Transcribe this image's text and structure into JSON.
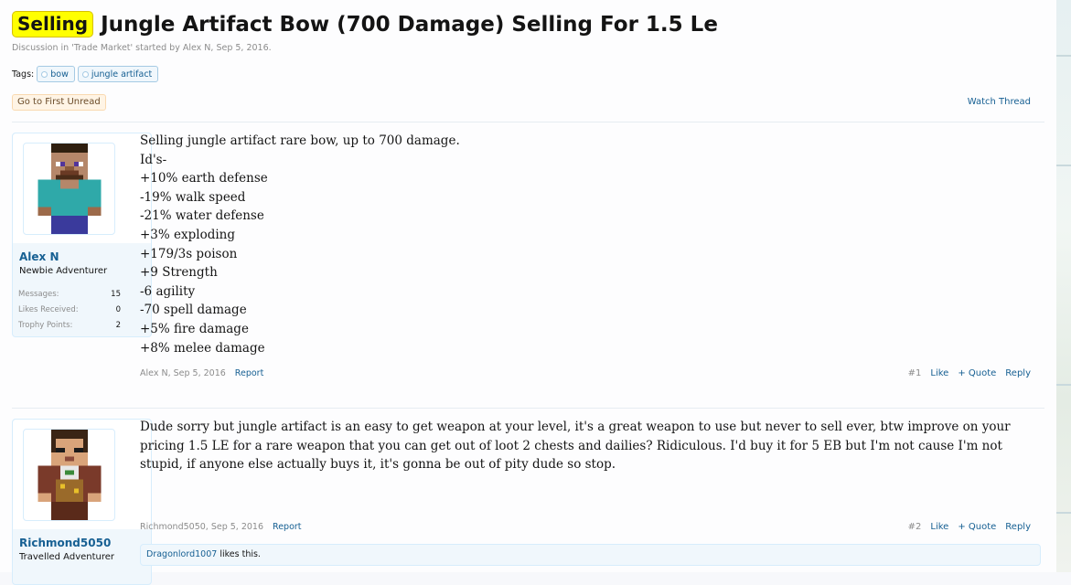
{
  "thread": {
    "prefix": "Selling",
    "title": "Jungle Artifact Bow (700 Damage) Selling For 1.5 Le",
    "description": "Discussion in 'Trade Market' started by Alex N, Sep 5, 2016.",
    "tags_label": "Tags:",
    "tags": [
      "bow",
      "jungle artifact"
    ],
    "go_first_unread": "Go to First Unread",
    "watch_thread": "Watch Thread"
  },
  "posts": [
    {
      "username": "Alex N",
      "user_title": "Newbie Adventurer",
      "stats": [
        {
          "label": "Messages:",
          "value": "15"
        },
        {
          "label": "Likes Received:",
          "value": "0"
        },
        {
          "label": "Trophy Points:",
          "value": "2"
        }
      ],
      "lines": [
        "Selling jungle artifact rare bow, up to 700 damage.",
        "Id's-",
        "+10% earth defense",
        "-19% walk speed",
        "-21% water defense",
        "+3% exploding",
        "+179/3s poison",
        "+9 Strength",
        "-6 agility",
        "-70 spell damage",
        "+5% fire damage",
        "+8% melee damage"
      ],
      "meta_author_date": "Alex N, Sep 5, 2016",
      "report": "Report",
      "number": "#1",
      "like": "Like",
      "quote": "+ Quote",
      "reply": "Reply"
    },
    {
      "username": "Richmond5050",
      "user_title": "Travelled Adventurer",
      "text": "Dude sorry but jungle artifact is an easy to get weapon at your level, it's a great weapon to use but never to sell ever, btw improve on your pricing 1.5 LE for a rare weapon that you can get out of loot 2 chests and dailies? Ridiculous. I'd buy it for 5 EB but I'm not cause I'm not stupid, if anyone else actually buys it, it's gonna be out of pity dude so stop.",
      "meta_author_date": "Richmond5050, Sep 5, 2016",
      "report": "Report",
      "number": "#2",
      "like": "Like",
      "quote": "+ Quote",
      "reply": "Reply",
      "likes_by": "Dragonlord1007",
      "likes_suffix": "likes this."
    }
  ],
  "colors": {
    "link": "#176093",
    "prefix_bg": "#ffff00",
    "panel_bg": "#f0f7fc",
    "panel_border": "#d7edfc"
  }
}
